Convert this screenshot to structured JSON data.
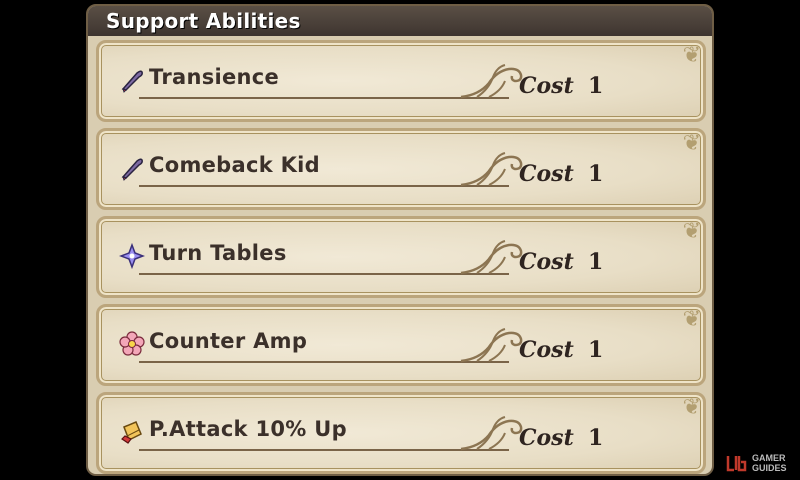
{
  "panel": {
    "title": "Support Abilities"
  },
  "abilities": [
    {
      "name": "Transience",
      "icon": "feather-pen-icon",
      "cost_label": "Cost",
      "cost": "1"
    },
    {
      "name": "Comeback Kid",
      "icon": "feather-pen-icon",
      "cost_label": "Cost",
      "cost": "1"
    },
    {
      "name": "Turn Tables",
      "icon": "purple-star-icon",
      "cost_label": "Cost",
      "cost": "1"
    },
    {
      "name": "Counter Amp",
      "icon": "pink-flower-icon",
      "cost_label": "Cost",
      "cost": "1"
    },
    {
      "name": "P.Attack 10% Up",
      "icon": "scroll-icon",
      "cost_label": "Cost",
      "cost": "1"
    }
  ],
  "watermark": {
    "line1": "GAMER",
    "line2": "GUIDES"
  },
  "colors": {
    "background": "#000000",
    "title_bar": "#4a403a",
    "card": "#ece3cd",
    "card_border": "#bba57c",
    "text": "#3b302a"
  }
}
